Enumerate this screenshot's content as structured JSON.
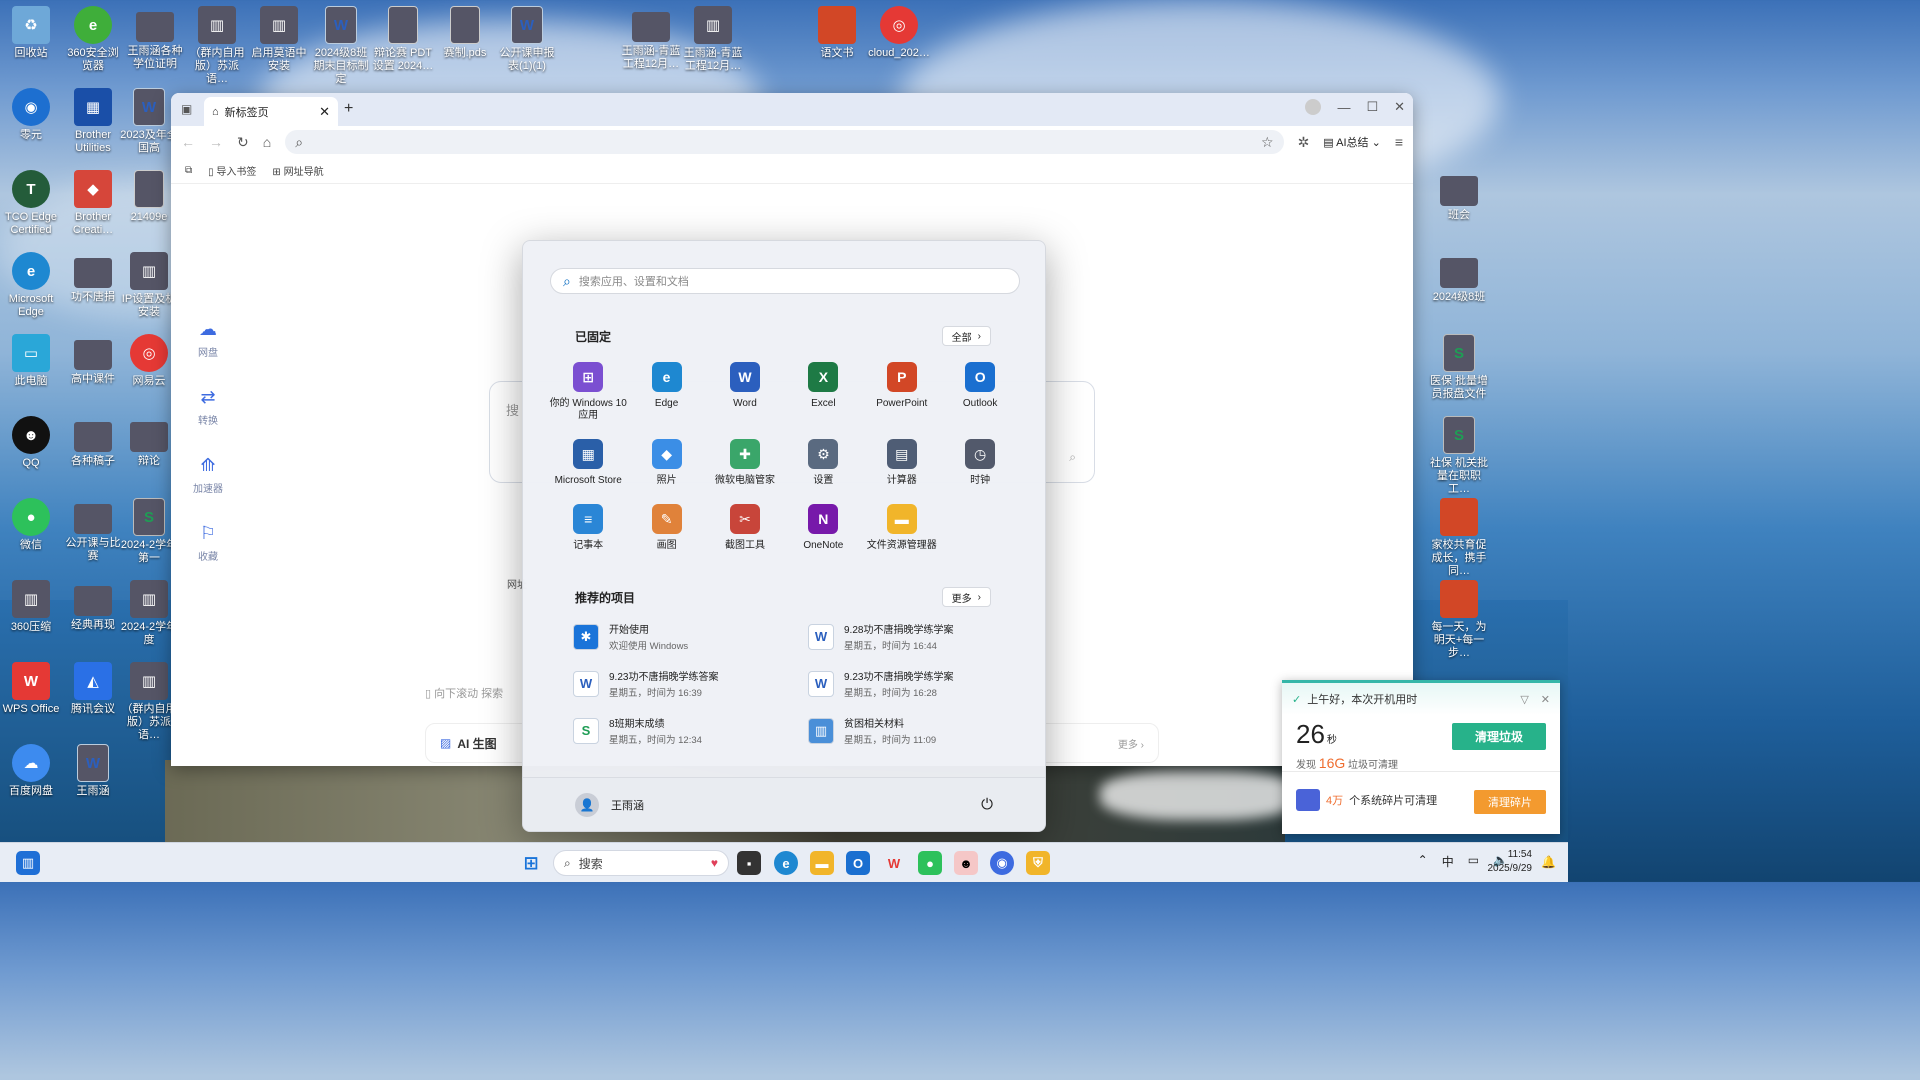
{
  "desktop": {
    "top_row": [
      {
        "label": "回收站",
        "icon": "recycle-bin-icon"
      },
      {
        "label": "360安全浏览器",
        "icon": "360-browser-icon"
      },
      {
        "label": "王雨涵各种学位证明",
        "icon": "folder-icon"
      },
      {
        "label": "（群内自用版）苏派语…",
        "icon": "zip-icon"
      },
      {
        "label": "启用莫语中安装",
        "icon": "zip-icon"
      },
      {
        "label": "2024级8班期末目标制定",
        "icon": "word-doc-icon"
      },
      {
        "label": "辩论赛 PDT 设置 2024…",
        "icon": "file-icon"
      },
      {
        "label": "赛制.pds",
        "icon": "file-icon"
      },
      {
        "label": "公开课申报表(1)(1)",
        "icon": "word-doc-icon"
      },
      {
        "label": "王雨涵-青蓝工程12月…",
        "icon": "folder-icon"
      },
      {
        "label": "王雨涵-青蓝工程12月…",
        "icon": "zip-icon"
      },
      {
        "label": "语文书",
        "icon": "ppt-icon"
      },
      {
        "label": "cloud_202…",
        "icon": "netease-icon"
      }
    ],
    "left_col1": [
      {
        "label": "零元",
        "icon": "app-icon"
      },
      {
        "label": "TCO Edge Certified",
        "icon": "tco-icon"
      },
      {
        "label": "Microsoft Edge",
        "icon": "edge-icon"
      },
      {
        "label": "此电脑",
        "icon": "computer-icon"
      },
      {
        "label": "QQ",
        "icon": "qq-icon"
      },
      {
        "label": "微信",
        "icon": "wechat-icon"
      },
      {
        "label": "360压缩",
        "icon": "zip-icon"
      },
      {
        "label": "WPS Office",
        "icon": "wps-icon"
      },
      {
        "label": "百度网盘",
        "icon": "baidu-netdisk-icon"
      }
    ],
    "left_col2": [
      {
        "label": "Brother Utilities",
        "icon": "brother-icon"
      },
      {
        "label": "Brother Creati…",
        "icon": "brother-creative-icon"
      },
      {
        "label": "功不唐捐",
        "icon": "folder-icon"
      },
      {
        "label": "高中课件",
        "icon": "folder-icon"
      },
      {
        "label": "各种稿子",
        "icon": "folder-icon"
      },
      {
        "label": "公开课与比赛",
        "icon": "folder-icon"
      },
      {
        "label": "经典再现",
        "icon": "folder-icon"
      },
      {
        "label": "腾讯会议",
        "icon": "tencent-meeting-icon"
      },
      {
        "label": "王雨涵",
        "icon": "word-doc-icon"
      }
    ],
    "left_col3": [
      {
        "label": "2023及年全国高",
        "icon": "word-doc-icon"
      },
      {
        "label": "21409e",
        "icon": "file-icon"
      },
      {
        "label": "IP设置及机安装",
        "icon": "zip-icon"
      },
      {
        "label": "网易云",
        "icon": "netease-icon"
      },
      {
        "label": "辩论",
        "icon": "folder-icon"
      },
      {
        "label": "2024-2学年第一",
        "icon": "sheet-icon"
      },
      {
        "label": "2024-2学年度",
        "icon": "zip-icon"
      },
      {
        "label": "（群内自用版）苏派语…",
        "icon": "zip-icon"
      }
    ],
    "right_col": [
      {
        "label": "班会",
        "icon": "folder-icon"
      },
      {
        "label": "2024级8班",
        "icon": "folder-icon"
      },
      {
        "label": "医保 批量增员报盘文件",
        "icon": "sheet-icon"
      },
      {
        "label": "社保 机关批量在职职工…",
        "icon": "sheet-icon"
      },
      {
        "label": "家校共育促成长，携手同…",
        "icon": "ppt-icon"
      },
      {
        "label": "每一天，为明天+每一步…",
        "icon": "ppt-icon"
      }
    ]
  },
  "browser": {
    "tab_title": "新标签页",
    "new_tab": "+",
    "bookmarks": [
      "导入书签",
      "网址导航"
    ],
    "ai_summary": "AI总结",
    "sidebar": [
      "网盘",
      "转换",
      "加速器",
      "收藏"
    ],
    "search_placeholder": "搜",
    "scroll_hint": "向下滚动 探索",
    "ai_gen": "AI 生图",
    "ai_more": "更多",
    "site_label": "网址"
  },
  "start_menu": {
    "search_placeholder": "搜索应用、设置和文档",
    "pinned_title": "已固定",
    "all_label": "全部",
    "pinned": [
      {
        "name": "你的 Windows 10 应用",
        "color": "#7b4fd1",
        "glyph": "⊞"
      },
      {
        "name": "Edge",
        "color": "#1e88d1",
        "glyph": "e"
      },
      {
        "name": "Word",
        "color": "#2b5fbe",
        "glyph": "W"
      },
      {
        "name": "Excel",
        "color": "#1e7a45",
        "glyph": "X"
      },
      {
        "name": "PowerPoint",
        "color": "#d24726",
        "glyph": "P"
      },
      {
        "name": "Outlook",
        "color": "#1a6fd0",
        "glyph": "O"
      },
      {
        "name": "Microsoft Store",
        "color": "#2a5fa8",
        "glyph": "▦"
      },
      {
        "name": "照片",
        "color": "#3b8ee6",
        "glyph": "◆"
      },
      {
        "name": "微软电脑管家",
        "color": "#3aa66a",
        "glyph": "✚"
      },
      {
        "name": "设置",
        "color": "#5a6a80",
        "glyph": "⚙"
      },
      {
        "name": "计算器",
        "color": "#4f5d75",
        "glyph": "▤"
      },
      {
        "name": "时钟",
        "color": "#52596b",
        "glyph": "◷"
      },
      {
        "name": "记事本",
        "color": "#2a86d6",
        "glyph": "≡"
      },
      {
        "name": "画图",
        "color": "#e0823a",
        "glyph": "✎"
      },
      {
        "name": "截图工具",
        "color": "#c8453a",
        "glyph": "✂"
      },
      {
        "name": "OneNote",
        "color": "#7719aa",
        "glyph": "N"
      },
      {
        "name": "文件资源管理器",
        "color": "#f1b52a",
        "glyph": "▬"
      }
    ],
    "rec_title": "推荐的项目",
    "more_label": "更多",
    "recommended": [
      {
        "title": "开始使用",
        "sub": "欢迎使用 Windows",
        "icon": "get-started-icon",
        "glyph": "✱",
        "bg": "#1a74d9",
        "fg": "#fff"
      },
      {
        "title": "9.28功不唐捐晚学练学案",
        "sub": "星期五，时间为 16:44",
        "icon": "word-doc-icon",
        "glyph": "W",
        "bg": "#fff",
        "fg": "#2b5fbe"
      },
      {
        "title": "9.23功不唐捐晚学练答案",
        "sub": "星期五，时间为 16:39",
        "icon": "word-doc-icon",
        "glyph": "W",
        "bg": "#fff",
        "fg": "#2b5fbe"
      },
      {
        "title": "9.23功不唐捐晚学练学案",
        "sub": "星期五，时间为 16:28",
        "icon": "word-doc-icon",
        "glyph": "W",
        "bg": "#fff",
        "fg": "#2b5fbe"
      },
      {
        "title": "8班期末成绩",
        "sub": "星期五，时间为 12:34",
        "icon": "sheet-icon",
        "glyph": "S",
        "bg": "#fff",
        "fg": "#1f9d55"
      },
      {
        "title": "贫困相关材料",
        "sub": "星期五，时间为 11:09",
        "icon": "zip-icon",
        "glyph": "▥",
        "bg": "#4a8fd8",
        "fg": "#fff"
      }
    ],
    "user": "王雨涵"
  },
  "popup": {
    "header": "上午好，本次开机用时",
    "seconds": "26",
    "sec_unit": "秒",
    "free_prefix": "发现",
    "free_size": "16G",
    "free_suffix": "垃圾可清理",
    "clean_btn": "清理垃圾",
    "frag_count": "4万",
    "frag_text": "个系统碎片可清理",
    "frag_btn": "清理碎片"
  },
  "taskbar": {
    "search": "搜索",
    "ime": "中",
    "time": "11:54",
    "date": "2025/9/29"
  },
  "colors": {
    "accent": "#0067c0",
    "green": "#27b28a",
    "orange": "#f39a2f"
  }
}
